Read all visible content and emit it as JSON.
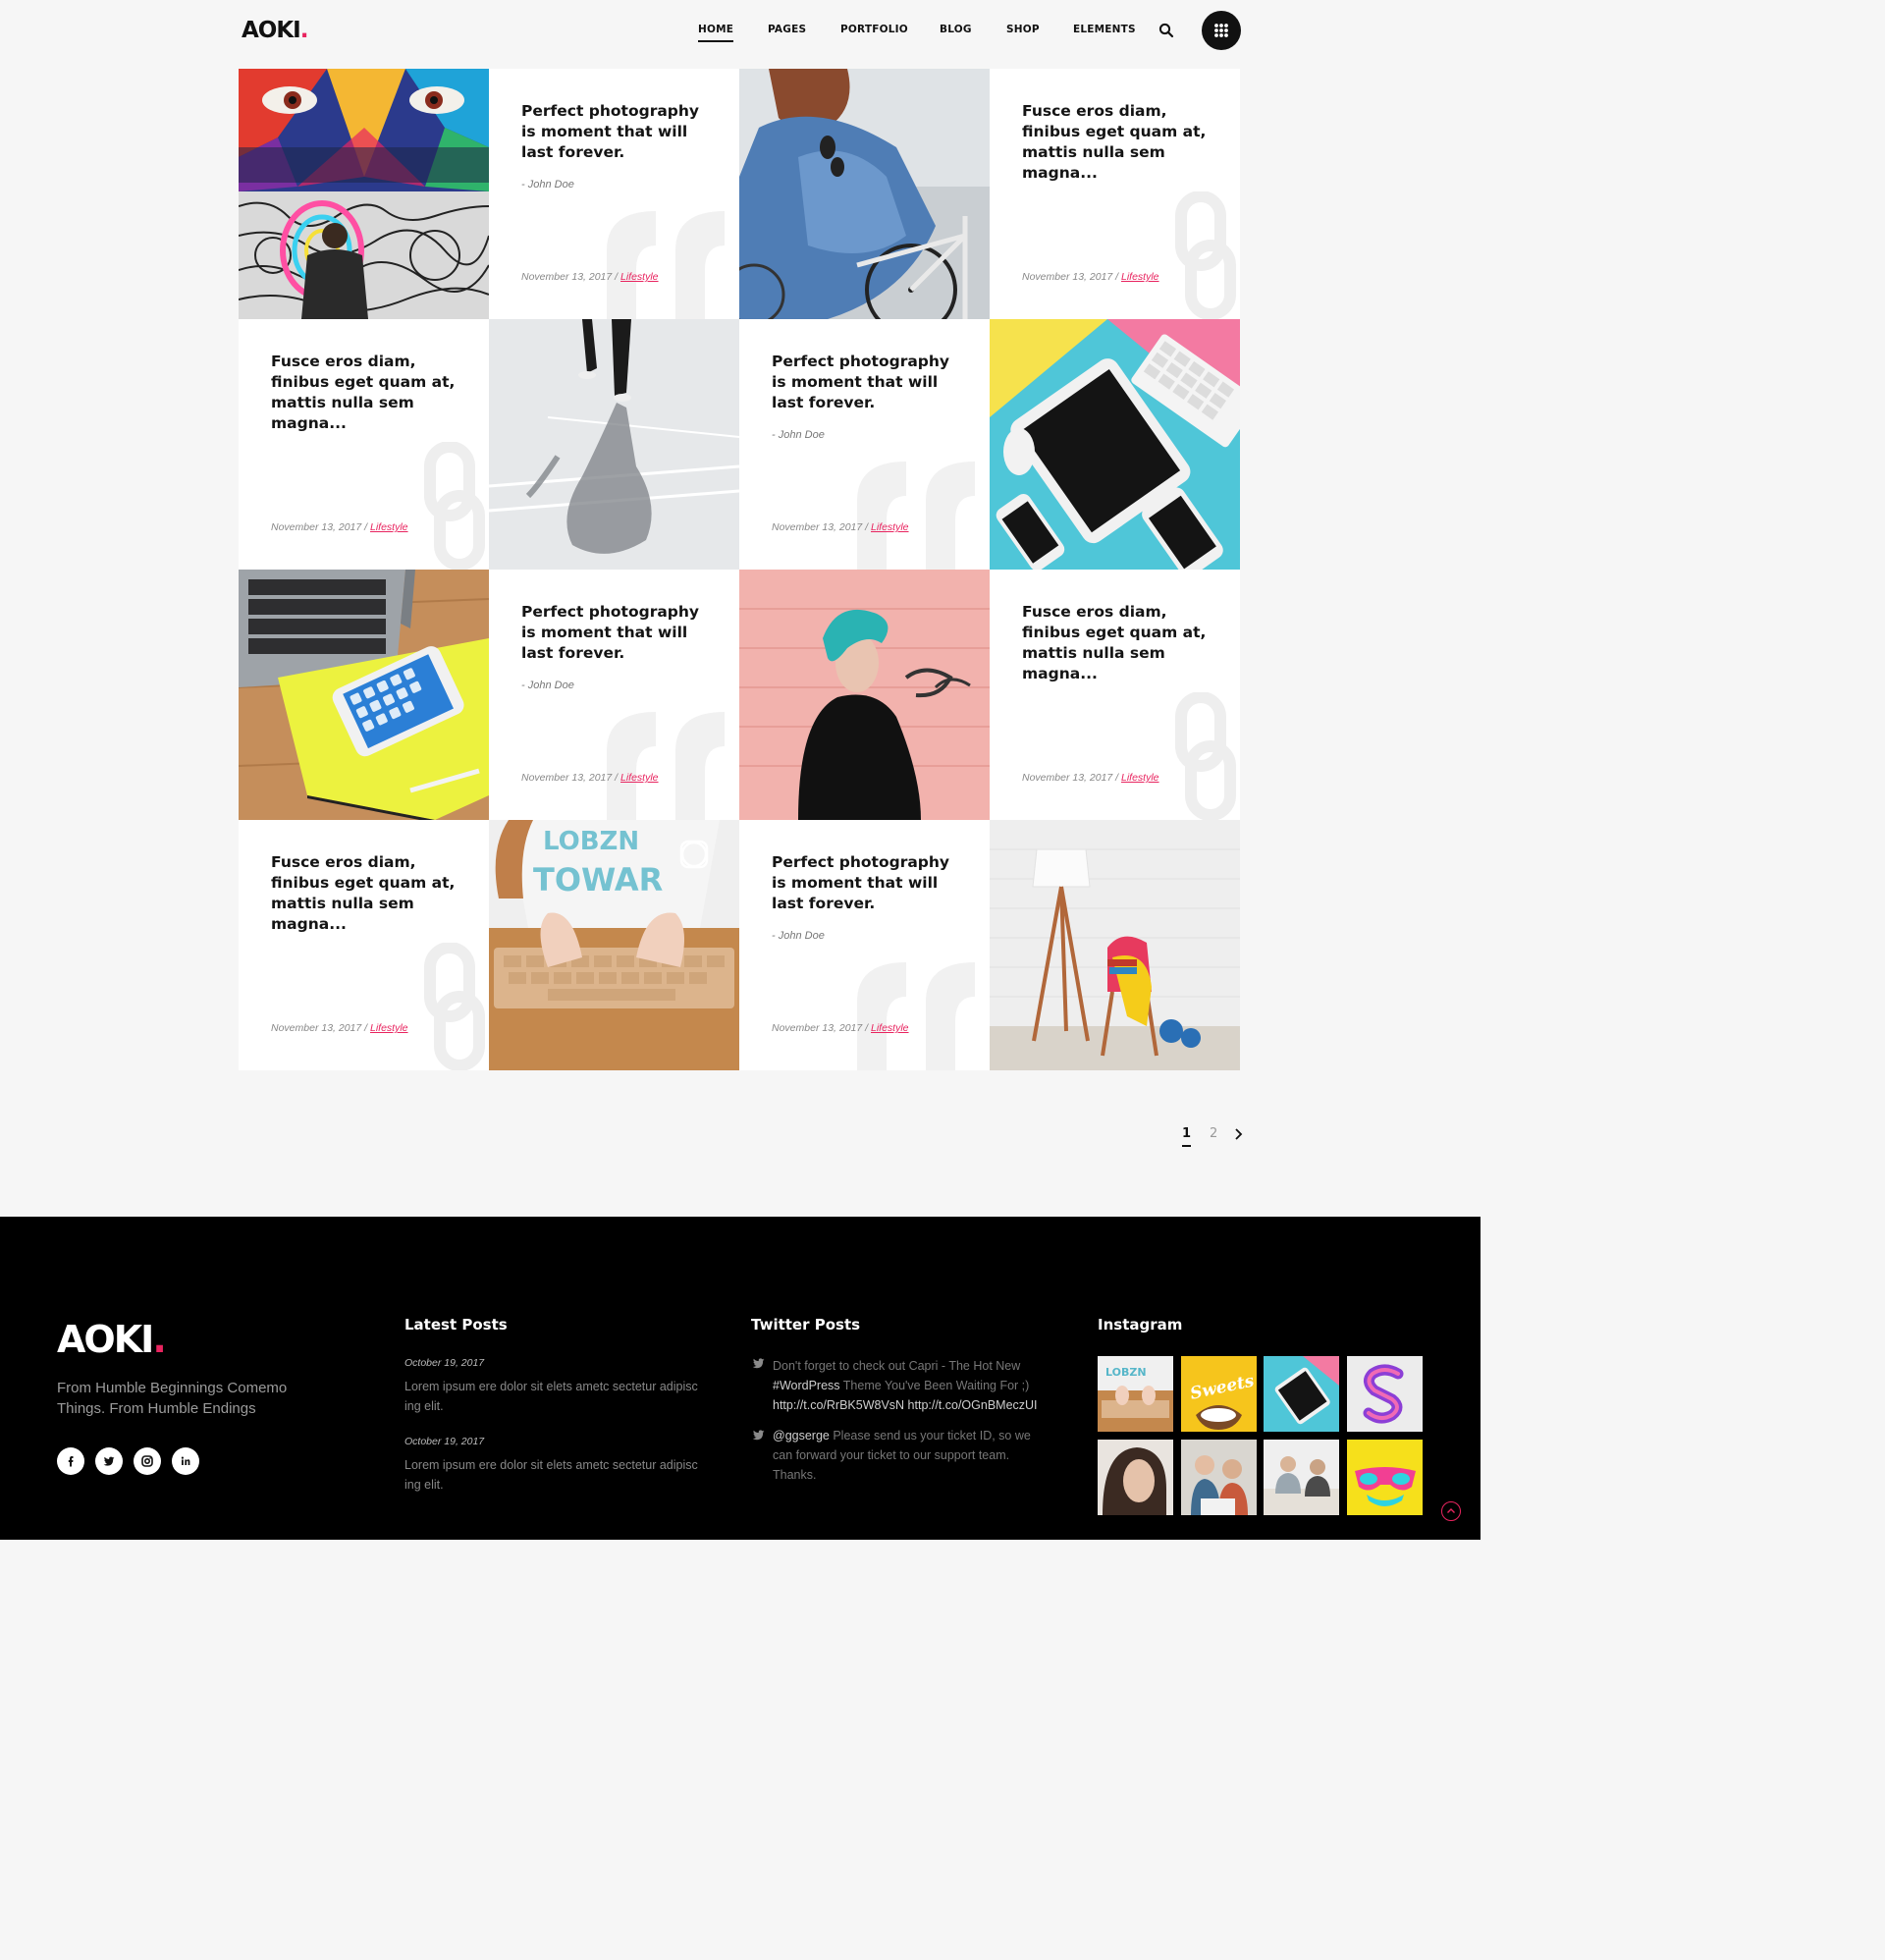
{
  "header": {
    "logo_text": "AOKI",
    "logo_dot": ".",
    "nav": [
      "HOME",
      "PAGES",
      "PORTFOLIO",
      "BLOG",
      "SHOP",
      "ELEMENTS"
    ],
    "active_nav": "HOME"
  },
  "grid": {
    "quote_card": {
      "title": "Perfect photography is moment that will last forever.",
      "author": "- John Doe",
      "date": "November 13, 2017",
      "separator": " / ",
      "category": "Lifestyle"
    },
    "link_card": {
      "title": "Fusce eros diam, finibus eget quam at, mattis nulla sem magna...",
      "date": "November 13, 2017",
      "separator": " / ",
      "category": "Lifestyle"
    },
    "image_names": [
      "street-art-photo",
      "cyclist-photo",
      "walking-shadow-photo",
      "tablet-flatlay-photo",
      "laptop-phone-photo",
      "teal-hair-woman-photo",
      "typing-keyboard-photo",
      "lamp-chair-photo"
    ]
  },
  "pagination": {
    "pages": [
      "1",
      "2"
    ],
    "current": "1"
  },
  "footer": {
    "logo_text": "AOKI",
    "logo_dot": ".",
    "tagline": "From Humble Beginnings Comemo Things. From Humble Endings",
    "social": [
      "facebook-icon",
      "twitter-icon",
      "instagram-icon",
      "linkedin-icon"
    ],
    "latest_posts": {
      "heading": "Latest Posts",
      "items": [
        {
          "date": "October 19, 2017",
          "excerpt": "Lorem ipsum ere dolor sit elets ametc sectetur adipisc ing elit."
        },
        {
          "date": "October 19, 2017",
          "excerpt": "Lorem ipsum ere dolor sit elets ametc sectetur adipisc ing elit."
        }
      ]
    },
    "twitter": {
      "heading": "Twitter Posts",
      "tweet1": {
        "a": "Don't forget to check out Capri - The Hot New ",
        "b": "#WordPress",
        "c": " Theme You've Been Waiting For ;) ",
        "d": "http://t.co/RrBK5W8VsN http://t.co/OGnBMeczUI"
      },
      "tweet2": {
        "a": "@ggserge",
        "b": " Please send us your ticket ID, so we can forward your ticket to our support team. Thanks."
      }
    },
    "instagram": {
      "heading": "Instagram"
    }
  },
  "colors": {
    "accent": "#e8245f",
    "footer_bg": "#000000",
    "page_bg": "#f6f6f6"
  }
}
